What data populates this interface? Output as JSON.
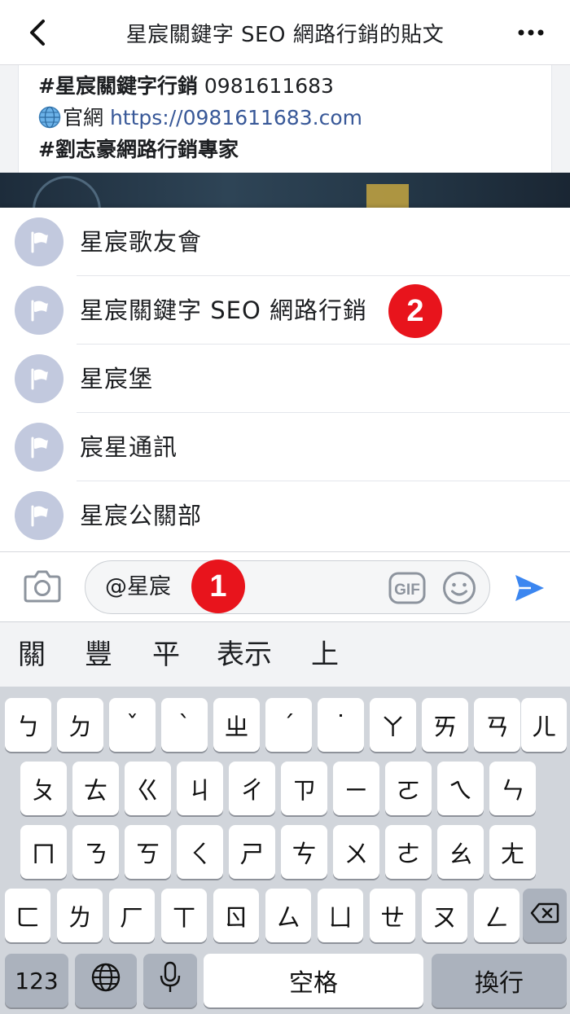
{
  "header": {
    "title": "星宸關鍵字 SEO 網路行銷的貼文"
  },
  "post": {
    "line1_tag": "#星宸關鍵字行銷",
    "line1_phone": " 0981611683",
    "line2_label": "官網 ",
    "line2_url": "https://0981611683.com",
    "line3_tag": "#劉志豪網路行銷專家"
  },
  "suggestions": [
    {
      "label": "星宸歌友會"
    },
    {
      "label": "星宸關鍵字 SEO 網路行銷"
    },
    {
      "label": "星宸堡"
    },
    {
      "label": "宸星通訊"
    },
    {
      "label": "星宸公關部"
    }
  ],
  "annotations": {
    "step1": "1",
    "step2": "2"
  },
  "composer": {
    "input_value": "@星宸",
    "gif_label": "GIF"
  },
  "candidates": [
    "關",
    "豐",
    "平",
    "表示",
    "上"
  ],
  "keyboard": {
    "row1": [
      "ㄅ",
      "ㄉ",
      "ˇ",
      "ˋ",
      "ㄓ",
      "ˊ",
      "˙",
      "ㄚ",
      "ㄞ",
      "ㄢ",
      "ㄦ"
    ],
    "row2": [
      "ㄆ",
      "ㄊ",
      "ㄍ",
      "ㄐ",
      "ㄔ",
      "ㄗ",
      "ㄧ",
      "ㄛ",
      "ㄟ",
      "ㄣ"
    ],
    "row3": [
      "ㄇ",
      "ㄋ",
      "ㄎ",
      "ㄑ",
      "ㄕ",
      "ㄘ",
      "ㄨ",
      "ㄜ",
      "ㄠ",
      "ㄤ"
    ],
    "row4": [
      "ㄈ",
      "ㄌ",
      "ㄏ",
      "ㄒ",
      "ㄖ",
      "ㄙ",
      "ㄩ",
      "ㄝ",
      "ㄡ",
      "ㄥ"
    ],
    "numbers_label": "123",
    "space_label": "空格",
    "return_label": "換行"
  }
}
